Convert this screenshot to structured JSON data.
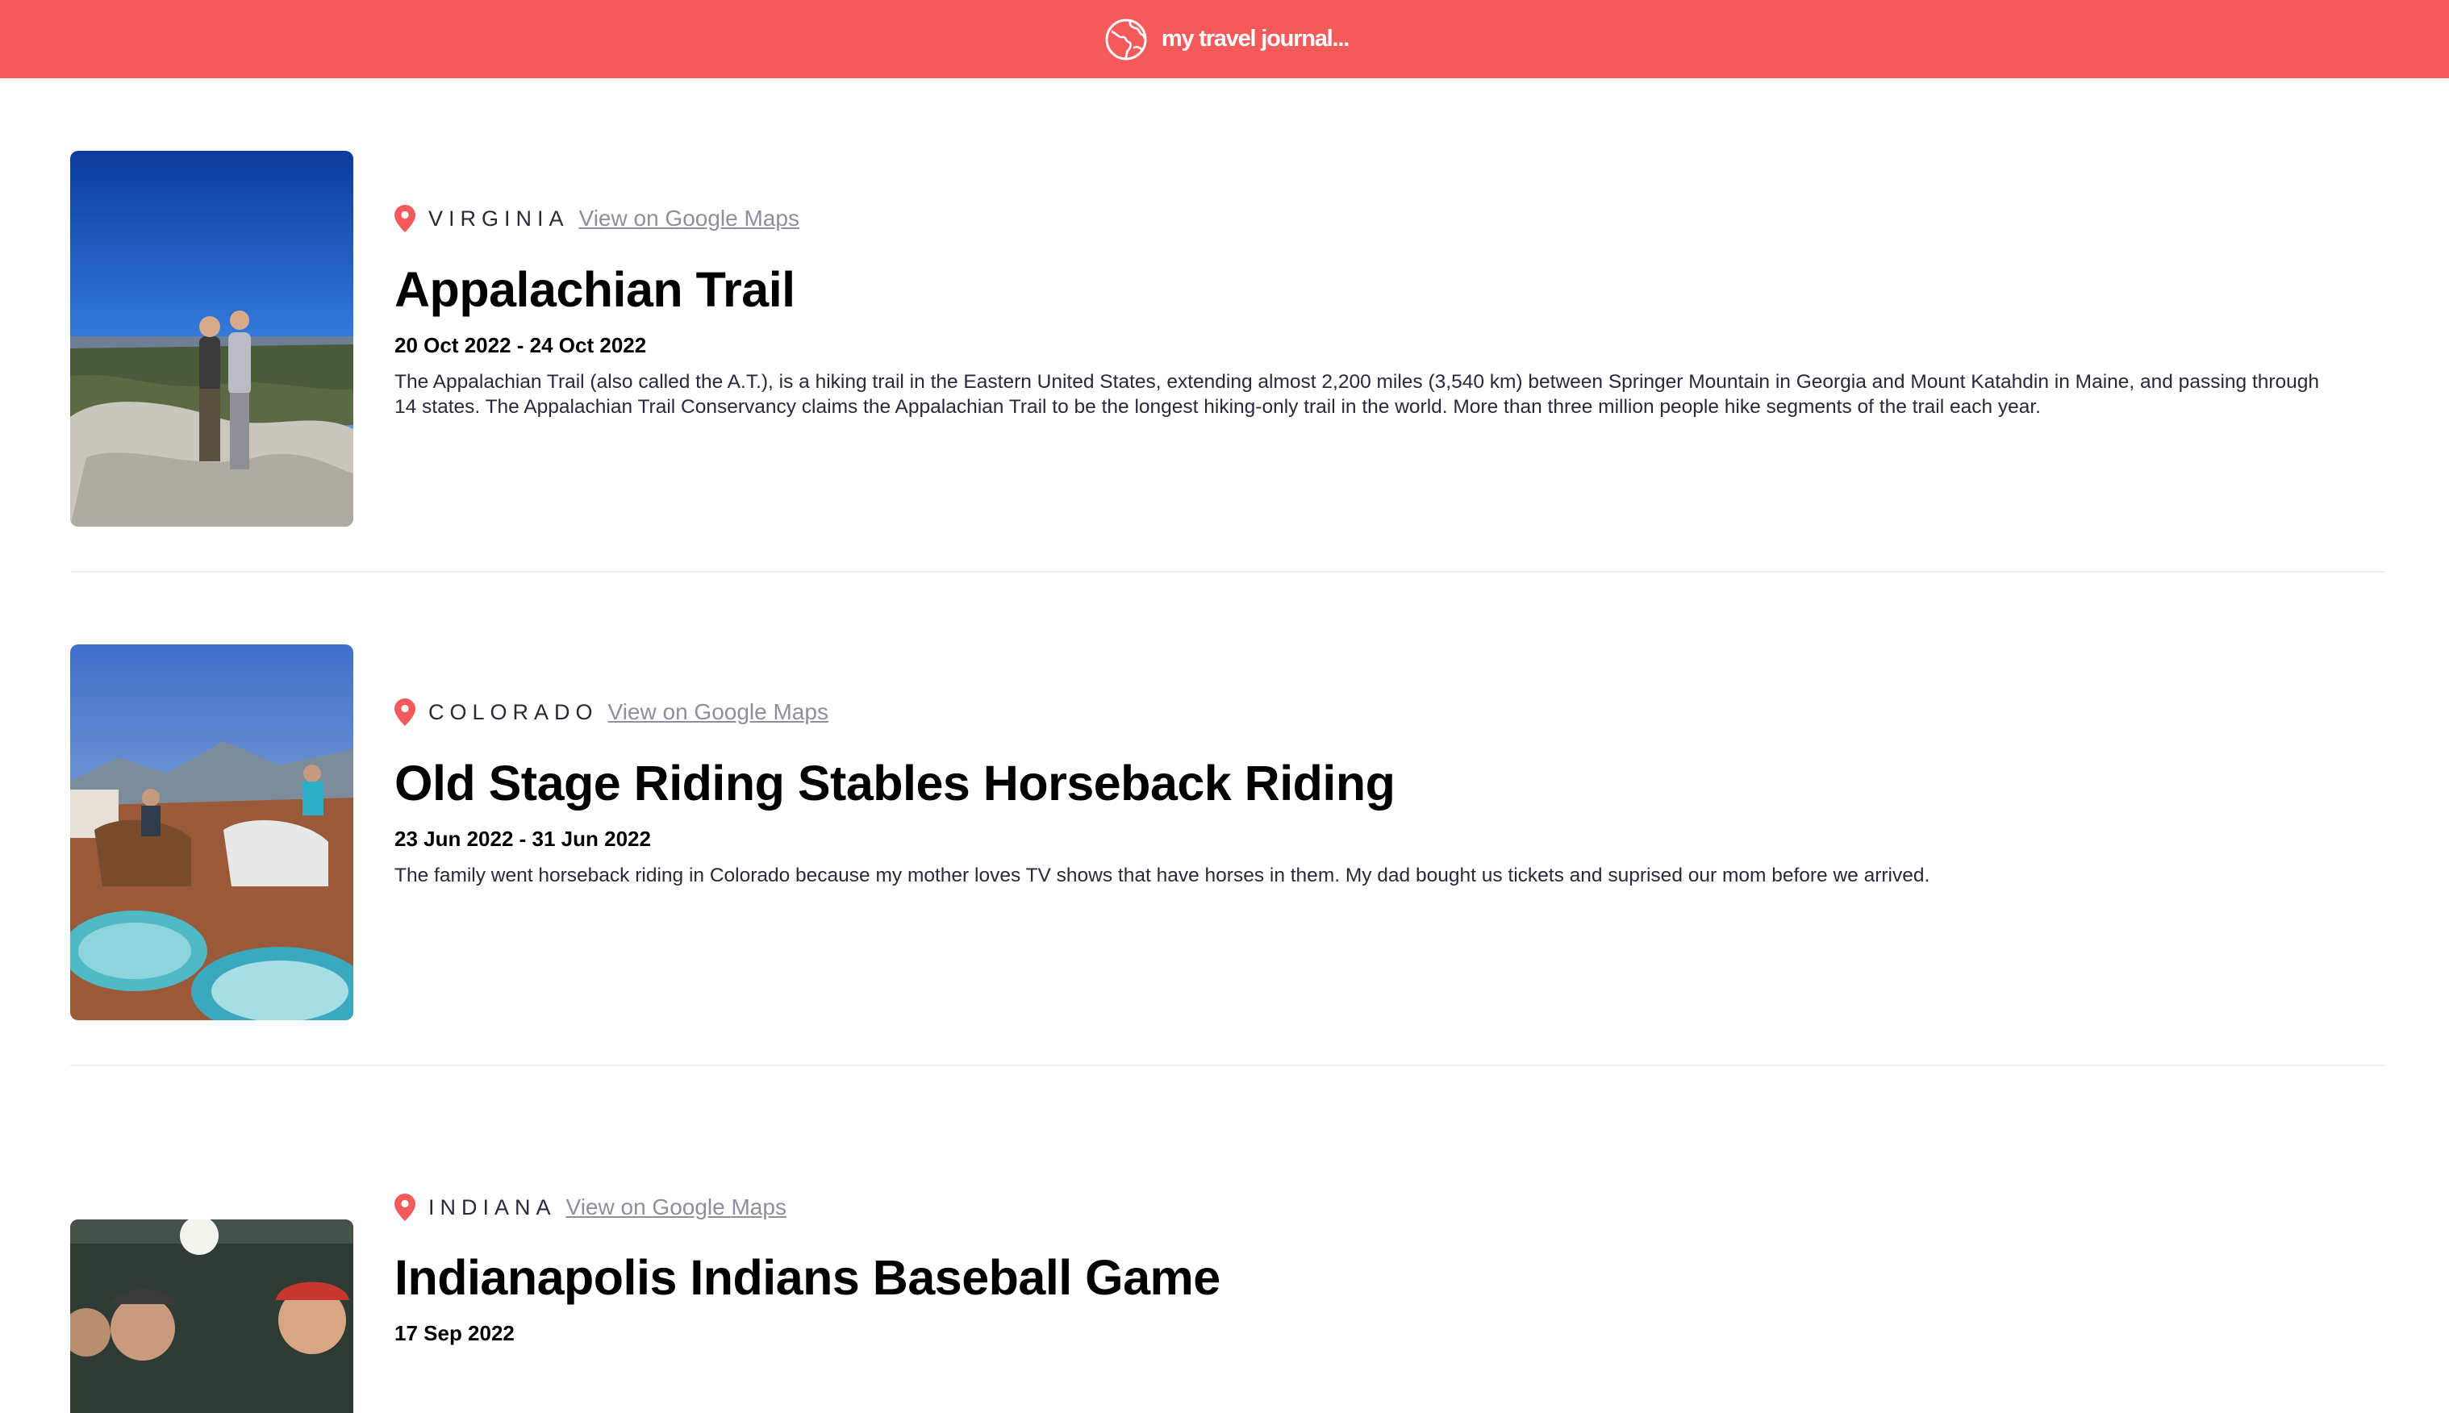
{
  "navbar": {
    "title": "my travel journal...",
    "icon": "globe-icon",
    "background_color": "#F55A5A"
  },
  "entries": [
    {
      "location": "VIRGINIA",
      "maps_link_label": "View on Google Maps",
      "title": "Appalachian Trail",
      "dates": "20 Oct 2022 - 24 Oct 2022",
      "description": "The Appalachian Trail (also called the A.T.), is a hiking trail in the Eastern United States, extending almost 2,200 miles (3,540 km) between Springer Mountain in Georgia and Mount Katahdin in Maine, and passing through 14 states. The Appalachian Trail Conservancy claims the Appalachian Trail to be the longest hiking-only trail in the world. More than three million people hike segments of the trail each year."
    },
    {
      "location": "COLORADO",
      "maps_link_label": "View on Google Maps",
      "title": "Old Stage Riding Stables Horseback Riding",
      "dates": "23 Jun 2022 - 31 Jun 2022",
      "description": "The family went horseback riding in Colorado because my mother loves TV shows that have horses in them. My dad bought us tickets and suprised our mom before we arrived."
    },
    {
      "location": "INDIANA",
      "maps_link_label": "View on Google Maps",
      "title": "Indianapolis Indians Baseball Game",
      "dates": "17 Sep 2022"
    }
  ],
  "pin_icon": "location-pin-icon",
  "pin_color": "#F55A5A"
}
